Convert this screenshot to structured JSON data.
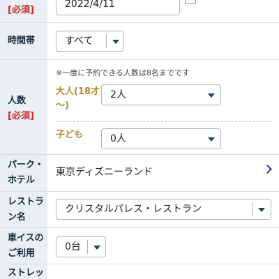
{
  "date_row": {
    "required": "[必須]",
    "value": "2022/4/11"
  },
  "time_row": {
    "label": "時間帯",
    "value": "すべて"
  },
  "people_row": {
    "label": "人数",
    "required": "[必須]",
    "note": "※一度に予約できる人数は8名までです",
    "adult_label_line1": "大人(18才",
    "adult_label_line2": "〜)",
    "adult_value": "2人",
    "child_label": "子ども",
    "child_value": "0人"
  },
  "park_row": {
    "label_line1": "パーク・",
    "label_line2": "ホテル",
    "value": "東京ディズニーランド"
  },
  "restaurant_row": {
    "label_line1": "レストラ",
    "label_line2": "ン名",
    "value": "クリスタルパレス・レストラン"
  },
  "wheelchair_row": {
    "label_line1": "車イスの",
    "label_line2": "ご利用",
    "value": "0台"
  },
  "stroller_row": {
    "label_line1": "ストレッ"
  }
}
